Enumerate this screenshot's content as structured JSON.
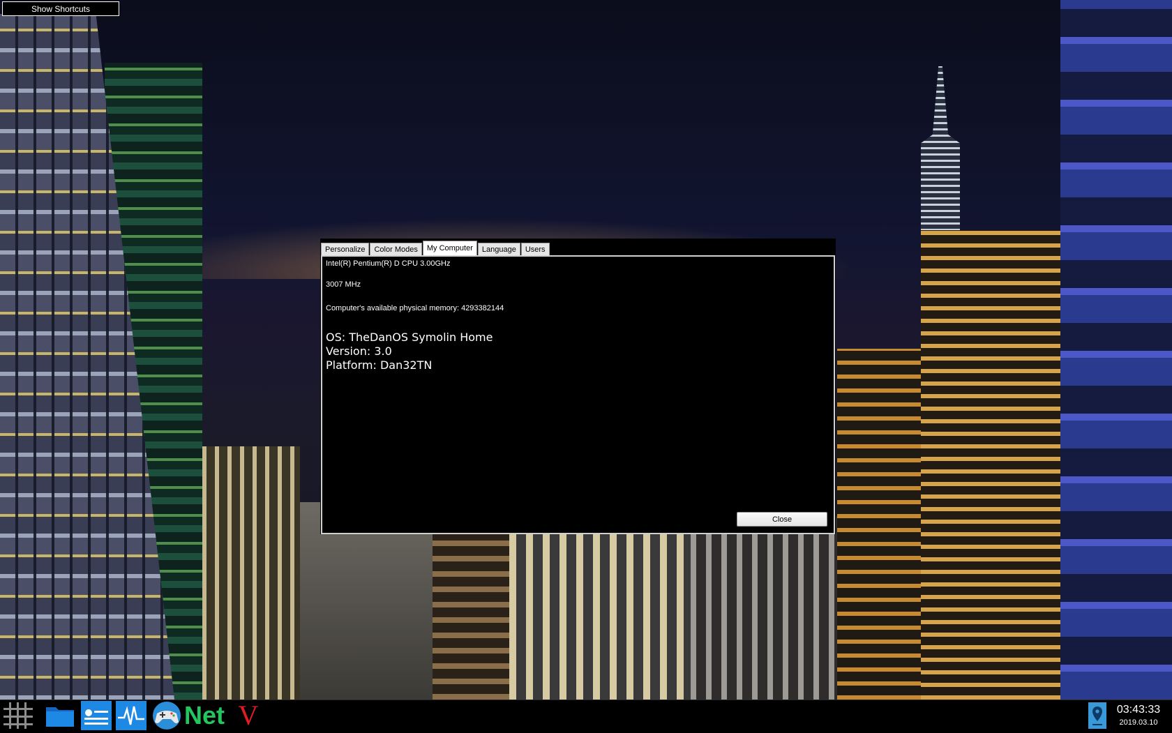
{
  "desktop": {
    "wallpaper": "night-city-skyline",
    "show_shortcuts_label": "Show Shortcuts"
  },
  "settings_window": {
    "tabs": [
      {
        "label": "Personalize",
        "active": false
      },
      {
        "label": "Color Modes",
        "active": false
      },
      {
        "label": "My Computer",
        "active": true
      },
      {
        "label": "Language",
        "active": false
      },
      {
        "label": "Users",
        "active": false
      }
    ],
    "my_computer": {
      "cpu": "Intel(R) Pentium(R) D CPU 3.00GHz",
      "speed": "3007 MHz",
      "memory": "Computer's available physical memory: 4293382144",
      "os": "OS: TheDanOS Symolin Home",
      "version": "Version: 3.0",
      "platform": "Platform: Dan32TN"
    },
    "close_label": "Close"
  },
  "taskbar": {
    "icons": [
      "apps-grid-icon",
      "folder-icon",
      "settings-panel-icon",
      "activity-monitor-icon",
      "gamepad-icon",
      "net-icon",
      "v-icon",
      "location-pin-icon"
    ],
    "net_label": "Net",
    "v_label": "V",
    "clock_time": "03:43:33",
    "clock_date": "2019.03.10"
  },
  "colors": {
    "taskbar_bg": "#000000",
    "folder_blue": "#1e88e5",
    "net_green": "#22c55e",
    "v_red": "#e11d24"
  }
}
